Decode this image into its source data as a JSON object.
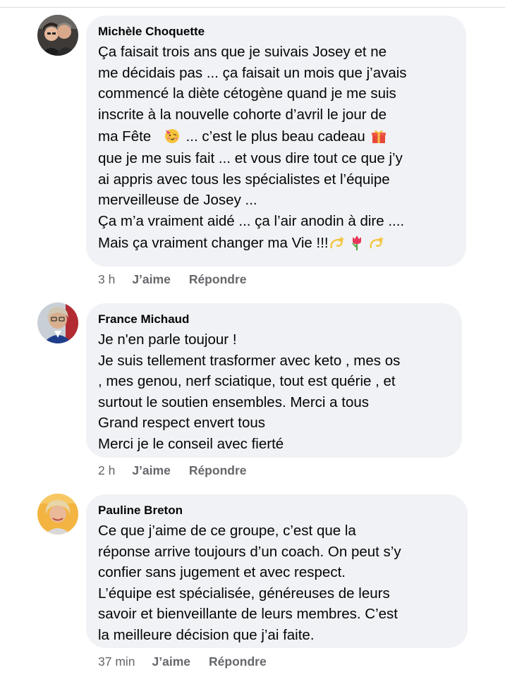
{
  "comments": [
    {
      "author": "Michèle Choquette",
      "avatar": "avatar-couple-photo",
      "lines": [
        "Ça faisait trois ans que je suivais Josey et ne",
        "me décidais pas ... ça faisait un mois que j’avais",
        "commencé la diète cétogène quand je me suis",
        "inscrite à la nouvelle cohorte d’avril le jour de",
        "ma Fête",
        "... c’est le plus beau cadeau",
        "que je me suis fait ... et vous dire tout ce que j’y",
        "ai appris avec tous les spécialistes et l’équipe",
        "merveilleuse de Josey ...",
        "Ça m’a vraiment aidé ... ça l’air anodin à dire ....",
        "Mais ça vraiment changer ma Vie !!!"
      ],
      "emojis": [
        "partying-face-icon",
        "gift-icon",
        "dizzy-icon",
        "tulip-icon",
        "dizzy-icon"
      ],
      "time": "3 h",
      "like_label": "J’aime",
      "reply_label": "Répondre"
    },
    {
      "author": "France Michaud",
      "avatar": "avatar-woman-glasses-photo",
      "lines": [
        "Je n'en parle toujour !",
        "Je suis tellement trasformer avec keto , mes os",
        ", mes genou, nerf sciatique, tout est quérie , et",
        "surtout le soutien ensembles.  Merci a tous",
        "Grand respect envert tous",
        "Merci je le conseil avec fierté"
      ],
      "time": "2 h",
      "like_label": "J’aime",
      "reply_label": "Répondre"
    },
    {
      "author": "Pauline Breton",
      "avatar": "avatar-woman-blonde-photo",
      "lines": [
        "Ce que j’aime de ce groupe, c’est que la",
        "réponse arrive toujours d’un coach.  On peut s’y",
        "confier sans jugement et avec respect.",
        "L’équipe est spécialisée, généreuses de leurs",
        "savoir et bienveillante de leurs membres.  C’est",
        "la meilleure décision que j’ai faite."
      ],
      "time": "37 min",
      "like_label": "J’aime",
      "reply_label": "Répondre"
    }
  ],
  "colors": {
    "bubble": "#f0f2f5",
    "text": "#050505",
    "meta": "#65676b"
  }
}
